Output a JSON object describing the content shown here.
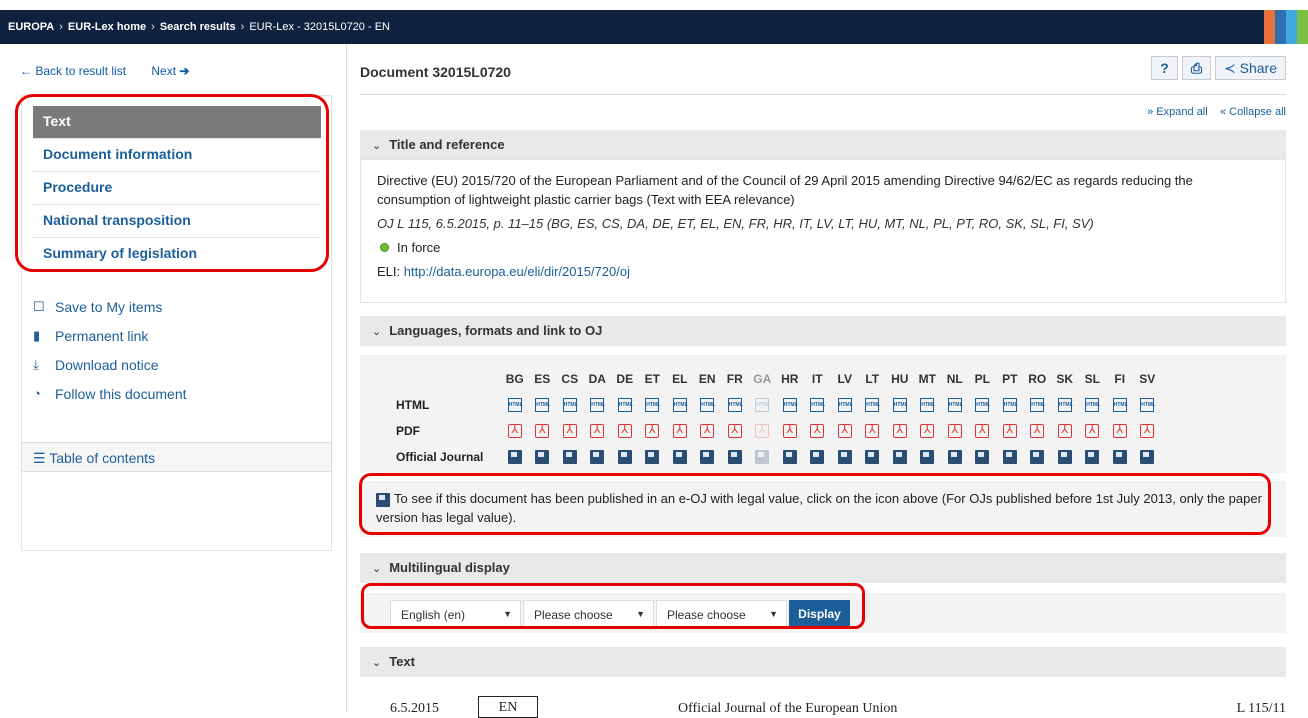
{
  "breadcrumb": [
    "EUROPA",
    "EUR-Lex home",
    "Search results",
    "EUR-Lex - 32015L0720 - EN"
  ],
  "colors": {
    "topbar": "#0e2240",
    "link": "#1c5e99",
    "highlight": "#e60000",
    "stripes": [
      "#e8733a",
      "#2e6fb2",
      "#3fa9e0",
      "#7ac143"
    ]
  },
  "nav": {
    "back": "Back to result list",
    "next": "Next"
  },
  "sidebar": {
    "items": [
      {
        "label": "Text",
        "active": true
      },
      {
        "label": "Document information"
      },
      {
        "label": "Procedure"
      },
      {
        "label": "National transposition"
      },
      {
        "label": "Summary of legislation"
      }
    ],
    "actions": [
      {
        "label": "Save to My items",
        "icon": "bookmark-outline-icon"
      },
      {
        "label": "Permanent link",
        "icon": "bookmark-filled-icon"
      },
      {
        "label": "Download notice",
        "icon": "download-icon"
      },
      {
        "label": "Follow this document",
        "icon": "rss-icon"
      }
    ],
    "toc": "Table of contents"
  },
  "document": {
    "title": "Document 32015L0720",
    "tools": {
      "help": "?",
      "share": "Share"
    },
    "expand_all": "Expand all",
    "collapse_all": "Collapse all"
  },
  "title_panel": {
    "heading": "Title and reference",
    "title": "Directive (EU) 2015/720 of the European Parliament and of the Council of 29 April 2015 amending Directive 94/62/EC as regards reducing the consumption of lightweight plastic carrier bags (Text with EEA relevance)",
    "oj_ref": "OJ L 115, 6.5.2015, p. 11–15 (BG, ES, CS, DA, DE, ET, EL, EN, FR, HR, IT, LV, LT, HU, MT, NL, PL, PT, RO, SK, SL, FI, SV)",
    "status": "In force",
    "eli_label": "ELI: ",
    "eli_url": "http://data.europa.eu/eli/dir/2015/720/oj"
  },
  "lang_panel": {
    "heading": "Languages, formats and link to OJ",
    "languages": [
      "BG",
      "ES",
      "CS",
      "DA",
      "DE",
      "ET",
      "EL",
      "EN",
      "FR",
      "GA",
      "HR",
      "IT",
      "LV",
      "LT",
      "HU",
      "MT",
      "NL",
      "PL",
      "PT",
      "RO",
      "SK",
      "SL",
      "FI",
      "SV"
    ],
    "disabled": [
      "GA"
    ],
    "rows": [
      "HTML",
      "PDF",
      "Official Journal"
    ],
    "notice": "To see if this document has been published in an e-OJ with legal value, click on the icon above (For OJs published before 1st July 2013, only the paper version has legal value)."
  },
  "multilingual": {
    "heading": "Multilingual display",
    "select1": "English (en)",
    "select2": "Please choose",
    "select3": "Please choose",
    "button": "Display"
  },
  "text_panel": {
    "heading": "Text",
    "date": "6.5.2015",
    "lang": "EN",
    "journal": "Official Journal of the European Union",
    "ref": "L 115/11"
  }
}
